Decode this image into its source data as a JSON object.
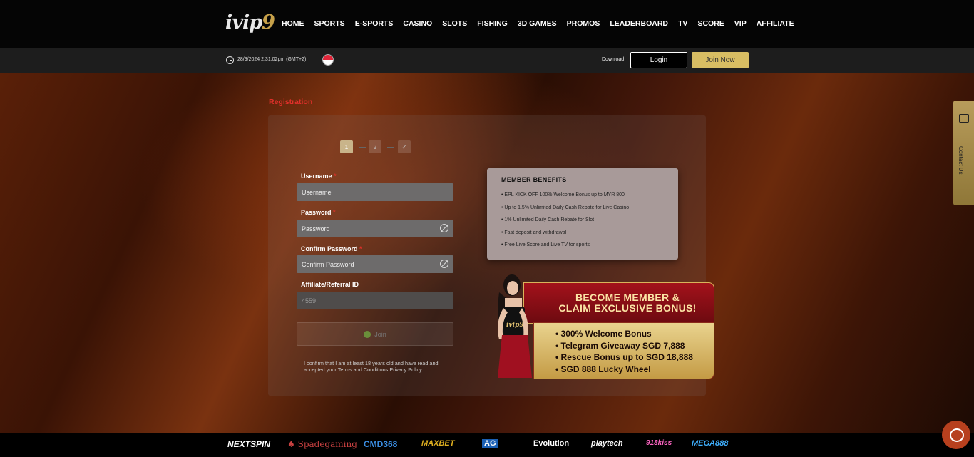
{
  "header": {
    "logo_main": "ivip",
    "logo_num": "9",
    "nav": [
      "HOME",
      "SPORTS",
      "E-SPORTS",
      "CASINO",
      "SLOTS",
      "FISHING",
      "3D GAMES",
      "PROMOS",
      "LEADERBOARD",
      "TV",
      "SCORE",
      "VIP",
      "AFFILIATE"
    ]
  },
  "subbar": {
    "datetime": "28/9/2024 2:31:02pm (GMT+2)",
    "download": "Download",
    "login": "Login",
    "join": "Join Now"
  },
  "registration": {
    "title": "Registration",
    "steps": [
      "1",
      "2",
      "✓"
    ],
    "username_label": "Username",
    "username_placeholder": "Username",
    "password_label": "Password",
    "password_placeholder": "Password",
    "confirm_label": "Confirm Password",
    "confirm_placeholder": "Confirm Password",
    "affiliate_label": "Affiliate/Referral ID",
    "affiliate_value": "4559",
    "submit": "Join",
    "confirm_text": "I confirm that I am at least 18 years old and have read and accepted your Terms and Conditions Privacy Policy"
  },
  "benefits": {
    "title": "MEMBER BENEFITS",
    "items": [
      "EPL KICK OFF 100% Welcome Bonus up to MYR 800",
      "Up to 1.5% Unlimited Daily Cash Rebate for Live Casino",
      "1% Unlimited Daily Cash Rebate for Slot",
      "Fast deposit and withdrawal",
      "Free Live Score and Live TV for sports"
    ]
  },
  "promo": {
    "headline1": "BECOME MEMBER &",
    "headline2": "CLAIM EXCLUSIVE BONUS!",
    "items": [
      "300% Welcome Bonus",
      "Telegram Giveaway SGD 7,888",
      "Rescue Bonus up to SGD 18,888",
      "SGD 888 Lucky Wheel"
    ]
  },
  "contact": {
    "label": "Contact Us"
  },
  "providers": [
    "NEXTSPIN",
    "Spadegaming",
    "CMD368",
    "MAXBET",
    "AG",
    "Evolution",
    "playtech",
    "918kiss",
    "MEGA888"
  ]
}
